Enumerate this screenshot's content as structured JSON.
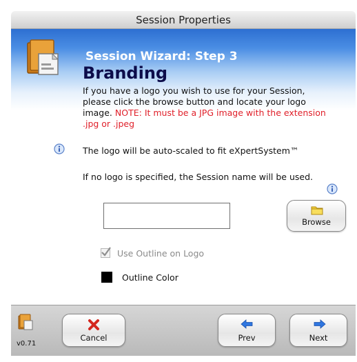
{
  "window": {
    "title": "Session Properties"
  },
  "wizard": {
    "step_title": "Session Wizard: Step 3",
    "section_title": "Branding",
    "intro_text": "If you have a logo you wish to use for your Session, please click the browse button and locate your logo image.",
    "intro_note": "NOTE: It must be a JPG image with the extension .jpg or .jpeg",
    "autoscale_text": "The logo will be auto-scaled to fit eXpertSystem™",
    "no_logo_text": "If no logo is specified, the Session name will be used."
  },
  "logo": {
    "path_value": "",
    "browse_label": "Browse"
  },
  "options": {
    "use_outline_label": "Use Outline on Logo",
    "use_outline_checked": true,
    "outline_color_label": "Outline Color",
    "outline_color": "#000000"
  },
  "footer": {
    "version": "v0.71",
    "cancel_label": "Cancel",
    "prev_label": "Prev",
    "next_label": "Next"
  },
  "colors": {
    "banner_top": "#2d6fd1",
    "note_red": "#e0202a",
    "title_navy": "#0c0c4a",
    "arrow_blue": "#2f76e0",
    "cancel_red": "#d4271e"
  },
  "icons": {
    "wizard": "session-document-icon",
    "info": "info-icon",
    "browse": "folder-icon",
    "cancel": "red-x-icon",
    "prev": "blue-left-arrow-icon",
    "next": "blue-right-arrow-icon"
  }
}
